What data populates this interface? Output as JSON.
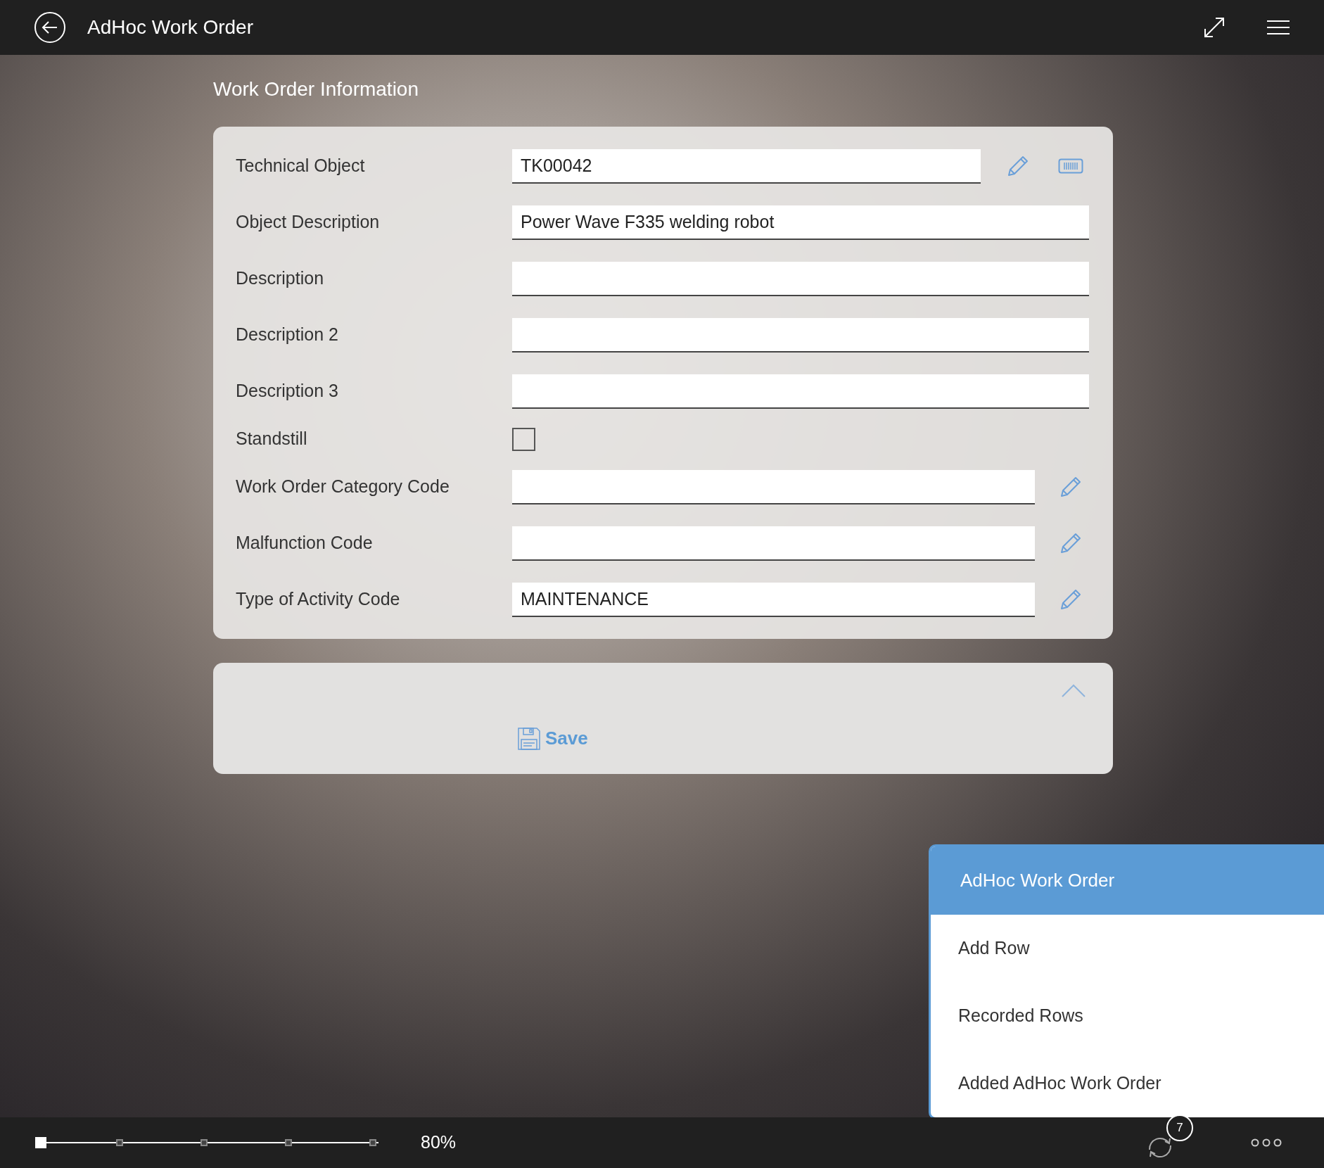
{
  "window": {
    "title": "AdHoc Work Order"
  },
  "section": {
    "title": "Work Order Information"
  },
  "fields": [
    {
      "kind": "lookup_scan",
      "label": "Technical Object",
      "value": "TK00042"
    },
    {
      "kind": "text",
      "label": "Object Description",
      "value": "Power Wave F335 welding robot"
    },
    {
      "kind": "text",
      "label": "Description"
    },
    {
      "kind": "text",
      "label": "Description 2"
    },
    {
      "kind": "text",
      "label": "Description 3"
    },
    {
      "kind": "checkbox",
      "label": "Standstill",
      "checked": false
    },
    {
      "kind": "lookup",
      "label": "Work Order Category Code"
    },
    {
      "kind": "lookup",
      "label": "Malfunction Code"
    },
    {
      "kind": "lookup",
      "label": "Type of Activity Code",
      "value": "MAINTENANCE"
    }
  ],
  "actions": {
    "expanded": true,
    "save_label": "Save"
  },
  "menu": {
    "title": "AdHoc Work Order",
    "items": [
      {
        "label": "Add Row"
      },
      {
        "label": "Recorded Rows"
      },
      {
        "label": "Added AdHoc Work Order"
      }
    ]
  },
  "status_bar": {
    "zoom": {
      "level": 0
    },
    "zoom_reading": "80%",
    "sync_count": "7"
  }
}
